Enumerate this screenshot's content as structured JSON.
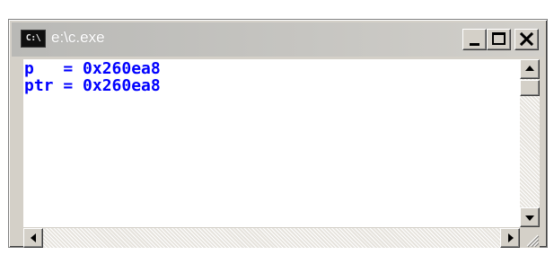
{
  "window": {
    "title": "e:\\c.exe",
    "icon_label": "C:\\",
    "icon_name": "console-app-icon"
  },
  "title_buttons": {
    "minimize_icon": "minimize-icon",
    "maximize_icon": "maximize-icon",
    "close_icon": "close-icon"
  },
  "console": {
    "text_color": "#0000ff",
    "background": "#ffffff",
    "lines": [
      "p   = 0x260ea8",
      "ptr = 0x260ea8"
    ]
  },
  "scrollbars": {
    "vertical_up_icon": "arrow-up-icon",
    "vertical_down_icon": "arrow-down-icon",
    "horizontal_left_icon": "arrow-left-icon",
    "horizontal_right_icon": "arrow-right-icon"
  }
}
